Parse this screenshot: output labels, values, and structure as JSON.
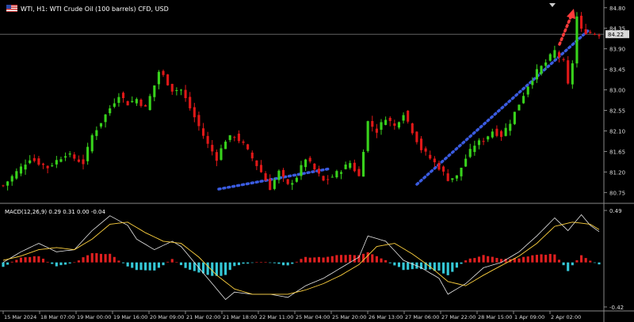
{
  "header": {
    "symbol_title": "WTI, H1:  WTI Crude Oil (100 barrels) CFD, USD",
    "indicator_title": "MACD(12,26,9) 0.29 0.31 0.00 -0.04"
  },
  "colors": {
    "bull": "#38d21c",
    "bear": "#e01818",
    "trend": "#3a5be0",
    "arrow": "#ff3b3b",
    "macd": "#e8e8e8",
    "signal": "#ffd23f",
    "hist_pos": "#e02020",
    "hist_neg": "#35c9d8",
    "grid": "#555555",
    "axis_text": "#dddddd"
  },
  "chart_data": [
    {
      "type": "candlestick",
      "symbol": "WTI",
      "timeframe": "H1",
      "y_ticks": [
        "84.80",
        "84.35",
        "83.90",
        "83.45",
        "83.00",
        "82.55",
        "82.10",
        "81.65",
        "81.20",
        "80.75"
      ],
      "current_price": "84.22",
      "x_ticks": [
        "15 Mar 2024",
        "18 Mar 07:00",
        "19 Mar 00:00",
        "19 Mar 16:00",
        "20 Mar 09:00",
        "21 Mar 02:00",
        "21 Mar 18:00",
        "22 Mar 11:00",
        "25 Mar 04:00",
        "25 Mar 20:00",
        "26 Mar 13:00",
        "27 Mar 06:00",
        "27 Mar 22:00",
        "28 Mar 15:00",
        "1 Apr 09:00",
        "2 Apr 02:00"
      ],
      "ylim": [
        80.6,
        84.9
      ],
      "close_path": [
        [
          0,
          80.9
        ],
        [
          6,
          81.5
        ],
        [
          10,
          81.3
        ],
        [
          14,
          81.6
        ],
        [
          18,
          81.4
        ],
        [
          20,
          82.0
        ],
        [
          24,
          82.6
        ],
        [
          26,
          82.9
        ],
        [
          28,
          82.7
        ],
        [
          30,
          82.8
        ],
        [
          32,
          82.6
        ],
        [
          34,
          83.1
        ],
        [
          35,
          83.4
        ],
        [
          36,
          83.3
        ],
        [
          38,
          83.0
        ],
        [
          40,
          83.0
        ],
        [
          42,
          82.6
        ],
        [
          44,
          82.2
        ],
        [
          46,
          81.8
        ],
        [
          48,
          81.5
        ],
        [
          50,
          81.9
        ],
        [
          52,
          82.0
        ],
        [
          54,
          81.8
        ],
        [
          56,
          81.5
        ],
        [
          58,
          81.2
        ],
        [
          60,
          80.85
        ],
        [
          62,
          81.2
        ],
        [
          64,
          80.9
        ],
        [
          66,
          81.1
        ],
        [
          68,
          81.5
        ],
        [
          70,
          81.25
        ],
        [
          72,
          81.0
        ],
        [
          74,
          81.1
        ],
        [
          76,
          81.25
        ],
        [
          78,
          81.4
        ],
        [
          80,
          81.1
        ],
        [
          82,
          82.3
        ],
        [
          84,
          82.1
        ],
        [
          86,
          82.4
        ],
        [
          88,
          82.2
        ],
        [
          90,
          82.5
        ],
        [
          92,
          82.1
        ],
        [
          94,
          81.7
        ],
        [
          96,
          81.5
        ],
        [
          98,
          81.3
        ],
        [
          100,
          81.05
        ],
        [
          102,
          81.1
        ],
        [
          104,
          81.5
        ],
        [
          106,
          81.8
        ],
        [
          108,
          81.9
        ],
        [
          110,
          82.1
        ],
        [
          112,
          82.0
        ],
        [
          114,
          82.3
        ],
        [
          116,
          82.7
        ],
        [
          118,
          83.1
        ],
        [
          120,
          83.4
        ],
        [
          122,
          83.6
        ],
        [
          124,
          83.85
        ],
        [
          126,
          83.6
        ],
        [
          127,
          83.1
        ],
        [
          128,
          83.6
        ],
        [
          129,
          84.6
        ],
        [
          130,
          84.3
        ],
        [
          132,
          84.25
        ],
        [
          134,
          84.22
        ]
      ]
    },
    {
      "type": "macd",
      "name": "MACD(12,26,9)",
      "y_ticks": [
        "0.49",
        "-0.42"
      ],
      "ylim": [
        -0.45,
        0.52
      ],
      "macd": [
        [
          0,
          0.0
        ],
        [
          4,
          0.1
        ],
        [
          8,
          0.18
        ],
        [
          12,
          0.1
        ],
        [
          16,
          0.12
        ],
        [
          20,
          0.3
        ],
        [
          24,
          0.44
        ],
        [
          28,
          0.35
        ],
        [
          30,
          0.22
        ],
        [
          34,
          0.12
        ],
        [
          38,
          0.2
        ],
        [
          40,
          0.15
        ],
        [
          44,
          -0.05
        ],
        [
          48,
          -0.25
        ],
        [
          50,
          -0.35
        ],
        [
          52,
          -0.28
        ],
        [
          56,
          -0.3
        ],
        [
          60,
          -0.3
        ],
        [
          64,
          -0.33
        ],
        [
          68,
          -0.22
        ],
        [
          72,
          -0.15
        ],
        [
          76,
          -0.05
        ],
        [
          80,
          0.05
        ],
        [
          82,
          0.25
        ],
        [
          86,
          0.2
        ],
        [
          90,
          0.02
        ],
        [
          94,
          -0.05
        ],
        [
          98,
          -0.15
        ],
        [
          100,
          -0.3
        ],
        [
          104,
          -0.2
        ],
        [
          108,
          -0.05
        ],
        [
          112,
          0.0
        ],
        [
          116,
          0.1
        ],
        [
          120,
          0.25
        ],
        [
          124,
          0.42
        ],
        [
          127,
          0.3
        ],
        [
          130,
          0.45
        ],
        [
          132,
          0.35
        ],
        [
          134,
          0.29
        ]
      ],
      "signal": [
        [
          0,
          0.02
        ],
        [
          4,
          0.06
        ],
        [
          8,
          0.12
        ],
        [
          12,
          0.14
        ],
        [
          16,
          0.12
        ],
        [
          20,
          0.22
        ],
        [
          24,
          0.36
        ],
        [
          28,
          0.38
        ],
        [
          32,
          0.28
        ],
        [
          36,
          0.2
        ],
        [
          40,
          0.18
        ],
        [
          44,
          0.05
        ],
        [
          48,
          -0.12
        ],
        [
          52,
          -0.25
        ],
        [
          56,
          -0.3
        ],
        [
          60,
          -0.3
        ],
        [
          64,
          -0.3
        ],
        [
          68,
          -0.26
        ],
        [
          72,
          -0.2
        ],
        [
          76,
          -0.12
        ],
        [
          80,
          -0.02
        ],
        [
          84,
          0.15
        ],
        [
          88,
          0.18
        ],
        [
          92,
          0.08
        ],
        [
          96,
          -0.04
        ],
        [
          100,
          -0.18
        ],
        [
          104,
          -0.22
        ],
        [
          108,
          -0.12
        ],
        [
          112,
          -0.03
        ],
        [
          116,
          0.06
        ],
        [
          120,
          0.18
        ],
        [
          124,
          0.34
        ],
        [
          128,
          0.38
        ],
        [
          132,
          0.36
        ],
        [
          134,
          0.31
        ]
      ],
      "histogram": [
        [
          0,
          -0.04
        ],
        [
          4,
          0.05
        ],
        [
          8,
          0.06
        ],
        [
          12,
          -0.04
        ],
        [
          16,
          0.0
        ],
        [
          20,
          0.09
        ],
        [
          24,
          0.08
        ],
        [
          28,
          -0.04
        ],
        [
          30,
          -0.07
        ],
        [
          34,
          -0.08
        ],
        [
          38,
          0.03
        ],
        [
          40,
          -0.03
        ],
        [
          44,
          -0.1
        ],
        [
          48,
          -0.13
        ],
        [
          50,
          -0.12
        ],
        [
          52,
          -0.03
        ],
        [
          56,
          0.0
        ],
        [
          60,
          0.0
        ],
        [
          64,
          -0.03
        ],
        [
          68,
          0.05
        ],
        [
          72,
          0.05
        ],
        [
          76,
          0.07
        ],
        [
          80,
          0.07
        ],
        [
          82,
          0.1
        ],
        [
          86,
          0.02
        ],
        [
          90,
          -0.07
        ],
        [
          94,
          -0.06
        ],
        [
          98,
          -0.08
        ],
        [
          100,
          -0.12
        ],
        [
          104,
          0.02
        ],
        [
          108,
          0.07
        ],
        [
          112,
          0.03
        ],
        [
          116,
          0.04
        ],
        [
          120,
          0.07
        ],
        [
          124,
          0.08
        ],
        [
          127,
          -0.08
        ],
        [
          130,
          0.07
        ],
        [
          132,
          0.02
        ],
        [
          134,
          -0.02
        ]
      ]
    }
  ]
}
